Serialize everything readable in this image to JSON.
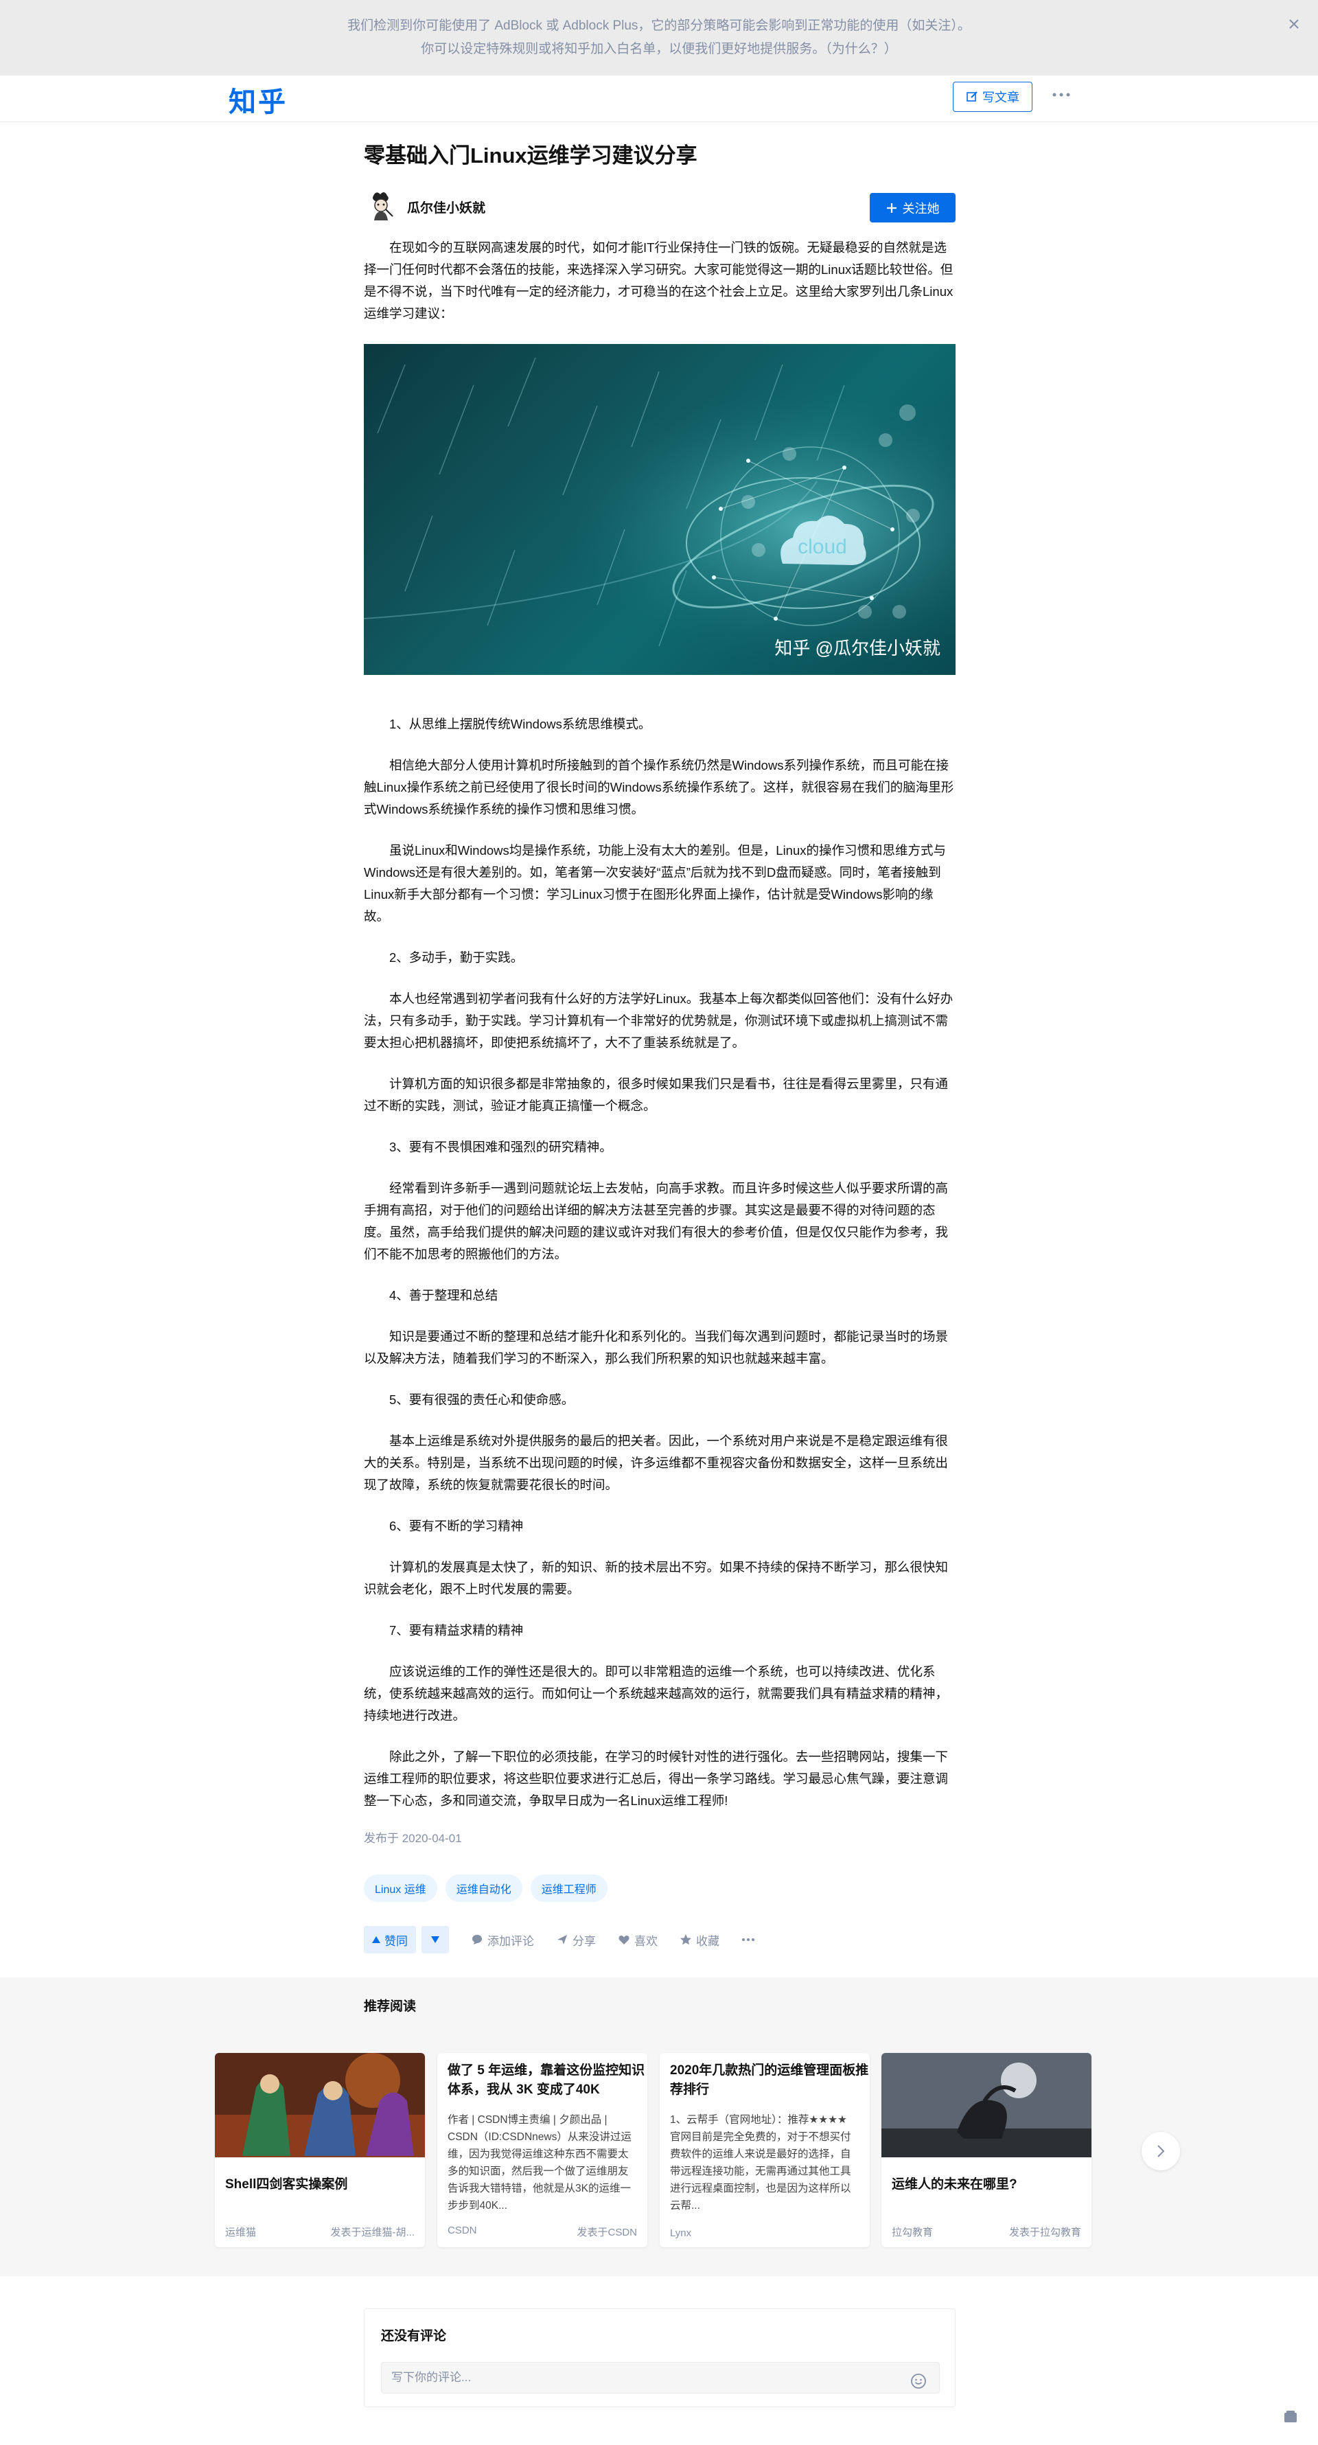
{
  "banner": {
    "line1": "我们检测到你可能使用了 AdBlock 或 Adblock Plus，它的部分策略可能会影响到正常功能的使用（如关注）。",
    "line2": "你可以设定特殊规则或将知乎加入白名单，以便我们更好地提供服务。（为什么？）"
  },
  "header": {
    "logo": "知乎",
    "write_label": "写文章"
  },
  "article": {
    "title": "零基础入门Linux运维学习建议分享",
    "author": "瓜尔佳小妖就",
    "follow_label": "关注她",
    "intro": "在现如今的互联网高速发展的时代，如何才能IT行业保持住一门铁的饭碗。无疑最稳妥的自然就是选择一门任何时代都不会落伍的技能，来选择深入学习研究。大家可能觉得这一期的Linux话题比较世俗。但是不得不说，当下时代唯有一定的经济能力，才可稳当的在这个社会上立足。这里给大家罗列出几条Linux运维学习建议：",
    "image_caption": "知乎 @瓜尔佳小妖就",
    "image_word": "cloud",
    "s1": "1、从思维上摆脱传统Windows系统思维模式。",
    "p1a": "相信绝大部分人使用计算机时所接触到的首个操作系统仍然是Windows系列操作系统，而且可能在接触Linux操作系统之前已经使用了很长时间的Windows系统操作系统了。这样，就很容易在我们的脑海里形式Windows系统操作系统的操作习惯和思维习惯。",
    "p1b": "虽说Linux和Windows均是操作系统，功能上没有太大的差别。但是，Linux的操作习惯和思维方式与Windows还是有很大差别的。如，笔者第一次安装好“蓝点”后就为找不到D盘而疑惑。同时，笔者接触到Linux新手大部分都有一个习惯：学习Linux习惯于在图形化界面上操作，估计就是受Windows影响的缘故。",
    "s2": "2、多动手，勤于实践。",
    "p2a": "本人也经常遇到初学者问我有什么好的方法学好Linux。我基本上每次都类似回答他们：没有什么好办法，只有多动手，勤于实践。学习计算机有一个非常好的优势就是，你测试环境下或虚拟机上搞测试不需要太担心把机器搞坏，即使把系统搞坏了，大不了重装系统就是了。",
    "p2b": "计算机方面的知识很多都是非常抽象的，很多时候如果我们只是看书，往往是看得云里雾里，只有通过不断的实践，测试，验证才能真正搞懂一个概念。",
    "s3": "3、要有不畏惧困难和强烈的研究精神。",
    "p3": "经常看到许多新手一遇到问题就论坛上去发帖，向高手求教。而且许多时候这些人似乎要求所谓的高手拥有高招，对于他们的问题给出详细的解决方法甚至完善的步骤。其实这是最要不得的对待问题的态度。虽然，高手给我们提供的解决问题的建议或许对我们有很大的参考价值，但是仅仅只能作为参考，我们不能不加思考的照搬他们的方法。",
    "s4": "4、善于整理和总结",
    "p4": "知识是要通过不断的整理和总结才能升化和系列化的。当我们每次遇到问题时，都能记录当时的场景以及解决方法，随着我们学习的不断深入，那么我们所积累的知识也就越来越丰富。",
    "s5": "5、要有很强的责任心和使命感。",
    "p5": "基本上运维是系统对外提供服务的最后的把关者。因此，一个系统对用户来说是不是稳定跟运维有很大的关系。特别是，当系统不出现问题的时候，许多运维都不重视容灾备份和数据安全，这样一旦系统出现了故障，系统的恢复就需要花很长的时间。",
    "s6": "6、要有不断的学习精神",
    "p6": "计算机的发展真是太快了，新的知识、新的技术层出不穷。如果不持续的保持不断学习，那么很快知识就会老化，跟不上时代发展的需要。",
    "s7": "7、要有精益求精的精神",
    "p7": "应该说运维的工作的弹性还是很大的。即可以非常粗造的运维一个系统，也可以持续改进、优化系统，使系统越来越高效的运行。而如何让一个系统越来越高效的运行，就需要我们具有精益求精的精神，持续地进行改进。",
    "p8": "除此之外，了解一下职位的必须技能，在学习的时候针对性的进行强化。去一些招聘网站，搜集一下运维工程师的职位要求，将这些职位要求进行汇总后，得出一条学习路线。学习最忌心焦气躁，要注意调整一下心态，多和同道交流，争取早日成为一名Linux运维工程师!",
    "pubdate": "发布于 2020-04-01",
    "tags": [
      "Linux 运维",
      "运维自动化",
      "运维工程师"
    ]
  },
  "actions": {
    "upvote": "赞同",
    "comment": "添加评论",
    "share": "分享",
    "like": "喜欢",
    "collect": "收藏"
  },
  "recommend": {
    "title": "推荐阅读",
    "cards": [
      {
        "title": "Shell四剑客实操案例",
        "excerpt": "",
        "source": "运维猫",
        "by": "发表于运维猫-胡..."
      },
      {
        "title": "做了 5 年运维，靠着这份监控知识体系，我从 3K 变成了40K",
        "excerpt": "作者 | CSDN博主责编 | 夕颜出品 | CSDN（ID:CSDNnews）从来没讲过运维，因为我觉得运维这种东西不需要太多的知识面，然后我一个做了运维朋友告诉我大错特错，他就是从3K的运维一步步到40K...",
        "source": "CSDN",
        "by": "发表于CSDN"
      },
      {
        "title": "2020年几款热门的运维管理面板推荐排行",
        "excerpt": "1、云帮手（官网地址）：推荐★★★★ 官网目前是完全免费的，对于不想买付费软件的运维人来说是最好的选择，自带远程连接功能，无需再通过其他工具进行远程桌面控制，也是因为这样所以云帮...",
        "source": "Lynx",
        "by": ""
      },
      {
        "title": "运维人的未来在哪里?",
        "excerpt": "",
        "source": "拉勾教育",
        "by": "发表于拉勾教育"
      }
    ]
  },
  "comments": {
    "title": "还没有评论",
    "placeholder": "写下你的评论..."
  },
  "colors": {
    "brand": "#056de8",
    "banner_bg": "#ebebeb",
    "muted": "#8590a6"
  }
}
